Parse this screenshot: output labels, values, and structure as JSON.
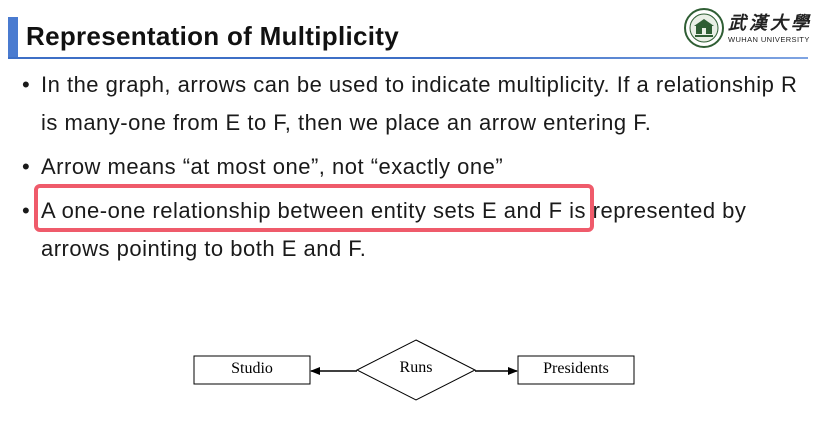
{
  "header": {
    "title": "Representation of Multiplicity"
  },
  "logo": {
    "name_cn": "武漢大學",
    "name_en": "WUHAN UNIVERSITY"
  },
  "bullets": [
    "In the graph, arrows can be used to indicate multiplicity. If a relationship R is many-one from E to F, then we place an arrow entering F.",
    "Arrow means “at most one”, not “exactly one”",
    "A one-one relationship between entity sets E and F is represented by arrows pointing to both E and F."
  ],
  "bullet_symbol": "•",
  "highlight": {
    "bullet_index": 1,
    "color": "#ef5b6b"
  },
  "diagram": {
    "left_entity": "Studio",
    "relationship": "Runs",
    "right_entity": "Presidents"
  },
  "colors": {
    "title_accent": "#4a7bd0",
    "title_rule": "#3d6fc6",
    "text": "#1a1a1a"
  }
}
